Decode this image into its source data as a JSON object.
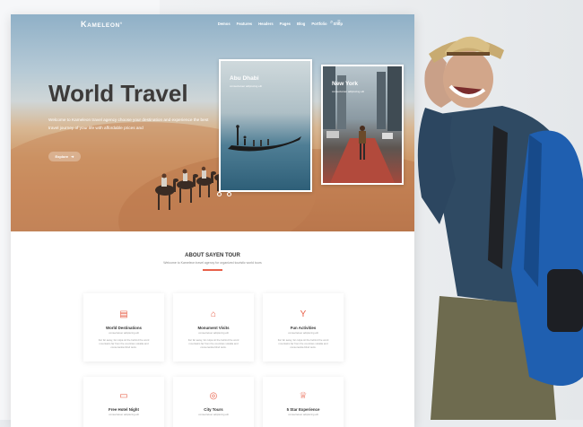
{
  "brand": {
    "logo_k": "K",
    "logo_rest": "AMELEON"
  },
  "nav": {
    "items": [
      "Demos",
      "Features",
      "Headers",
      "Pages",
      "Blog",
      "Portfolio",
      "Shop"
    ],
    "search_icon": "search-icon",
    "menu_icon": "hamburger-icon"
  },
  "hero": {
    "title": "World Travel",
    "text": "Welcome to Kameleon travel agency choose your destination and experience the best travel journey of your life with affordable prices and",
    "button_label": "Explore"
  },
  "destinations": [
    {
      "title": "Abu Dhabi",
      "subtitle": "consectetuer adipiscing elit"
    },
    {
      "title": "New York",
      "subtitle": "consectetuer adipiscing elit"
    }
  ],
  "about": {
    "title": "ABOUT SAYEN TOUR",
    "subtitle": "Welcome to Kameleon travel agency for organized touristic world tours"
  },
  "features": [
    {
      "title": "World Destinations",
      "subtitle": "consectetuer adipiscing elit",
      "desc": "Far far away, far culpa sit the behind the word mountains far from the countries vokalia and consonantia blind texts.",
      "icon": "map-icon"
    },
    {
      "title": "Monument Visits",
      "subtitle": "consectetuer adipiscing elit",
      "desc": "Far far away, far culpa sit the behind the word mountains far from the countries vokalia and consonantia blind texts.",
      "icon": "monument-icon"
    },
    {
      "title": "Fun Activities",
      "subtitle": "consectetuer adipiscing elit",
      "desc": "Far far away, far culpa sit the behind the word mountains far from the countries vokalia and consonantia blind texts.",
      "icon": "cocktail-icon"
    },
    {
      "title": "Free Hotel Night",
      "subtitle": "consectetuer adipiscing elit",
      "icon": "bed-icon"
    },
    {
      "title": "City Tours",
      "subtitle": "consectetuer adipiscing elit",
      "icon": "location-icon"
    },
    {
      "title": "5 Star Experience",
      "subtitle": "consectetuer adipiscing elit",
      "icon": "trophy-icon"
    }
  ],
  "colors": {
    "accent": "#e8614a",
    "heading": "#3d3b3a",
    "shirt": "#2f4a63",
    "backpack": "#1f5fb0"
  }
}
